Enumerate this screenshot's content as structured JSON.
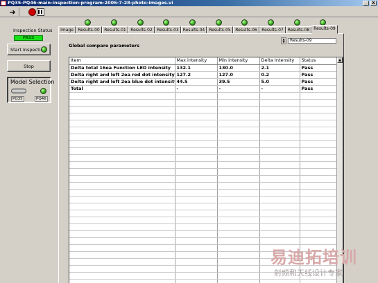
{
  "window": {
    "title": "PQ35-PQ46-main-inspection-program-2006-7-28-photo-images.vi",
    "minimize": "_",
    "close": "X"
  },
  "toolbar": {
    "run_icon": "run-arrow-icon",
    "abort_icon": "abort-icon",
    "pause_icon": "pause-icon"
  },
  "left_panel": {
    "inspection_status_label": "Inspection Status",
    "status_value": "PASS",
    "status_color": "#18e018",
    "start_button_label": "Start Inspection",
    "stop_button_label": "Stop",
    "model_selection": {
      "title": "Model Selection",
      "option_a": "PQ35",
      "option_b": "PQ46"
    }
  },
  "tabs": [
    {
      "label": "Image"
    },
    {
      "label": "Results-00"
    },
    {
      "label": "Results-01"
    },
    {
      "label": "Results-02"
    },
    {
      "label": "Results-03"
    },
    {
      "label": "Results-04"
    },
    {
      "label": "Results-05"
    },
    {
      "label": "Results-06"
    },
    {
      "label": "Results-07"
    },
    {
      "label": "Results-08"
    },
    {
      "label": "Results-09"
    }
  ],
  "active_tab": "Results-09",
  "panel": {
    "title": "Global compare parameters",
    "selector_value": "Results-09"
  },
  "table": {
    "headers": [
      "Item",
      "Max intensity",
      "Min intensity",
      "Delta Intensity",
      "Status"
    ],
    "rows": [
      [
        "Delta total 16ea Function LED intensity",
        "132.1",
        "130.0",
        "2.1",
        "Pass"
      ],
      [
        "Delta right and left 2ea red dot intensity",
        "127.2",
        "127.0",
        "0.2",
        "Pass"
      ],
      [
        "Delta right and left 2ea blue dot intensity",
        "44.5",
        "39.5",
        "5.0",
        "Pass"
      ],
      [
        "Total",
        "-",
        "-",
        "-",
        "Pass"
      ]
    ]
  },
  "watermark": {
    "main": "易迪拓培训",
    "sub": "射频和天线设计专家"
  }
}
